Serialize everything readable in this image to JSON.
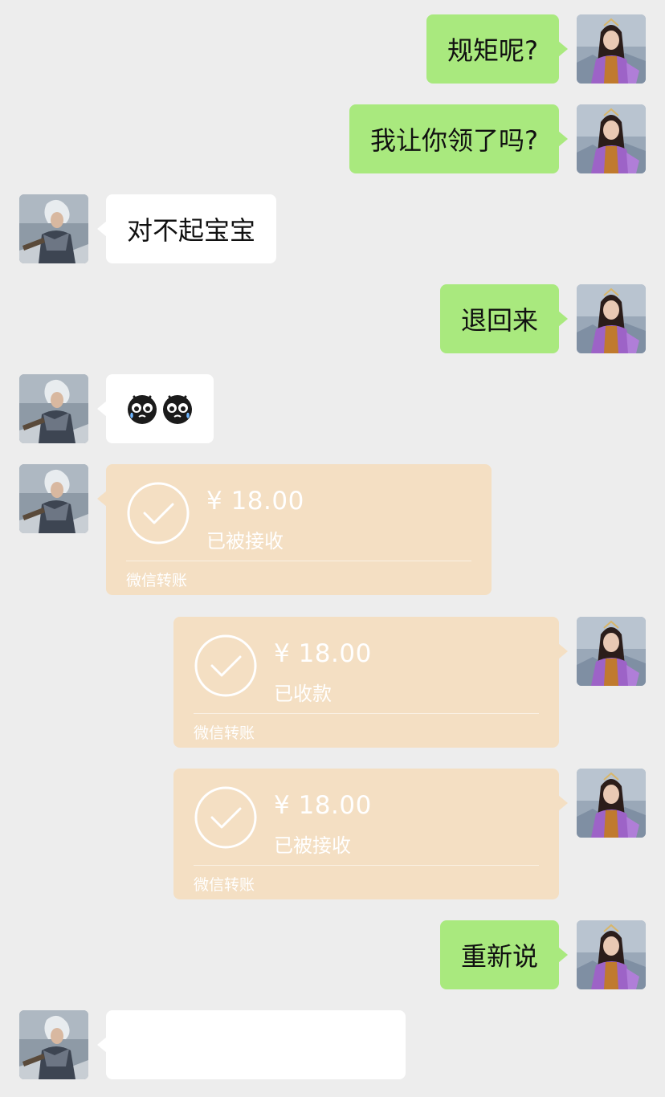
{
  "messages": {
    "m1": {
      "text": "规矩呢?"
    },
    "m2": {
      "text": "我让你领了吗?"
    },
    "m3": {
      "text": "对不起宝宝"
    },
    "m4": {
      "text": "退回来"
    },
    "m5": {
      "emojis": [
        "crying-face-emoji",
        "crying-face-emoji"
      ]
    },
    "m6": {
      "amount": "¥ 18.00",
      "status": "已被接收",
      "label": "微信转账"
    },
    "m7": {
      "amount": "¥ 18.00",
      "status": "已收款",
      "label": "微信转账"
    },
    "m8": {
      "amount": "¥ 18.00",
      "status": "已被接收",
      "label": "微信转账"
    },
    "m9": {
      "text": "重新说"
    },
    "m10": {
      "text": ""
    }
  },
  "colors": {
    "background": "#ededed",
    "my_bubble": "#a9e97e",
    "other_bubble": "#ffffff",
    "transfer_card": "#f4dfc3"
  },
  "icons": {
    "my_avatar": "female-character-avatar",
    "other_avatar": "male-warrior-avatar",
    "transfer_status": "check-circle-icon"
  }
}
